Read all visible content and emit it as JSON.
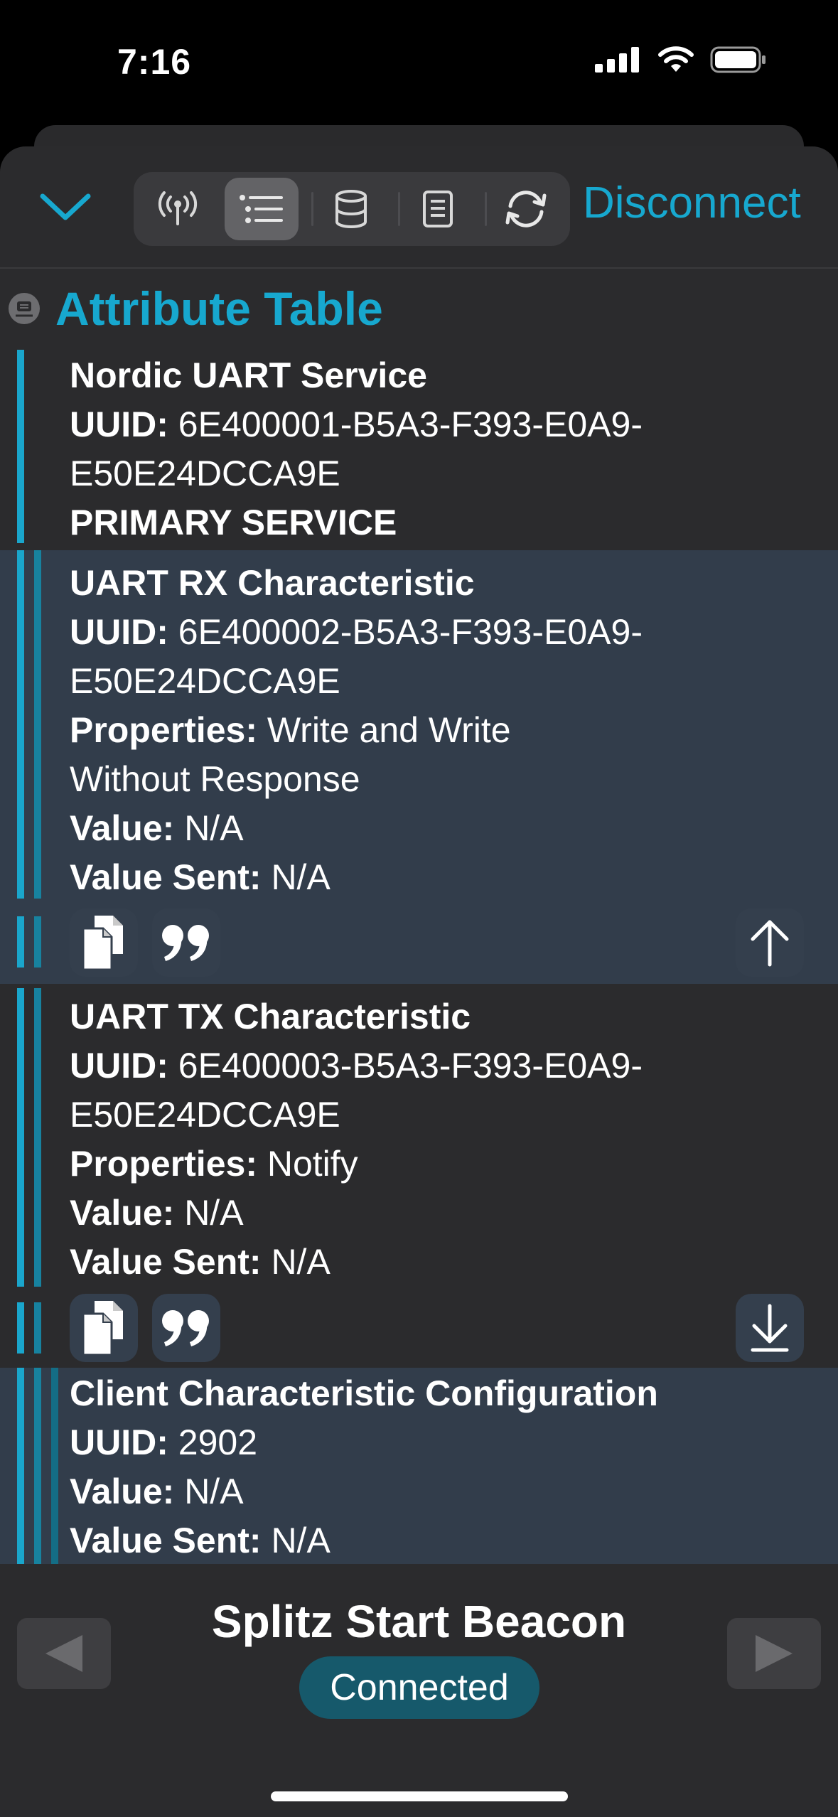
{
  "status_bar": {
    "time": "7:16"
  },
  "toolbar": {
    "collapse_icon": "chevron-down-icon",
    "segments": [
      "antenna-icon",
      "list-icon",
      "database-icon",
      "document-icon",
      "refresh-icon"
    ],
    "active_segment": "list-icon",
    "disconnect_label": "Disconnect",
    "accent_color": "#17a8cf"
  },
  "section": {
    "title": "Attribute Table"
  },
  "service": {
    "name": "Nordic UART Service",
    "uuid_label": "UUID:",
    "uuid_line1": "6E400001-B5A3-F393-E0A9-",
    "uuid_line2": "E50E24DCCA9E",
    "type": "PRIMARY SERVICE"
  },
  "rx": {
    "name": "UART RX Characteristic",
    "uuid_label": "UUID:",
    "uuid_line1": "6E400002-B5A3-F393-E0A9-",
    "uuid_line2": "E50E24DCCA9E",
    "properties_label": "Properties:",
    "properties_line1": "Write and Write",
    "properties_line2": "Without Response",
    "value_label": "Value:",
    "value": "N/A",
    "value_sent_label": "Value Sent:",
    "value_sent": "N/A",
    "action_icon": "arrow-up-icon"
  },
  "tx": {
    "name": "UART TX Characteristic",
    "uuid_label": "UUID:",
    "uuid_line1": "6E400003-B5A3-F393-E0A9-",
    "uuid_line2": "E50E24DCCA9E",
    "properties_label": "Properties:",
    "properties": "Notify",
    "value_label": "Value:",
    "value": "N/A",
    "value_sent_label": "Value Sent:",
    "value_sent": "N/A",
    "action_icon": "arrow-down-to-line-icon"
  },
  "cccd": {
    "name": "Client Characteristic Configuration",
    "uuid_label": "UUID:",
    "uuid": "2902",
    "value_label": "Value:",
    "value": "N/A",
    "value_sent_label": "Value Sent:",
    "value_sent": "N/A"
  },
  "footer": {
    "device_name": "Splitz Start Beacon",
    "status": "Connected",
    "prev_icon": "triangle-left-icon",
    "next_icon": "triangle-right-icon"
  }
}
